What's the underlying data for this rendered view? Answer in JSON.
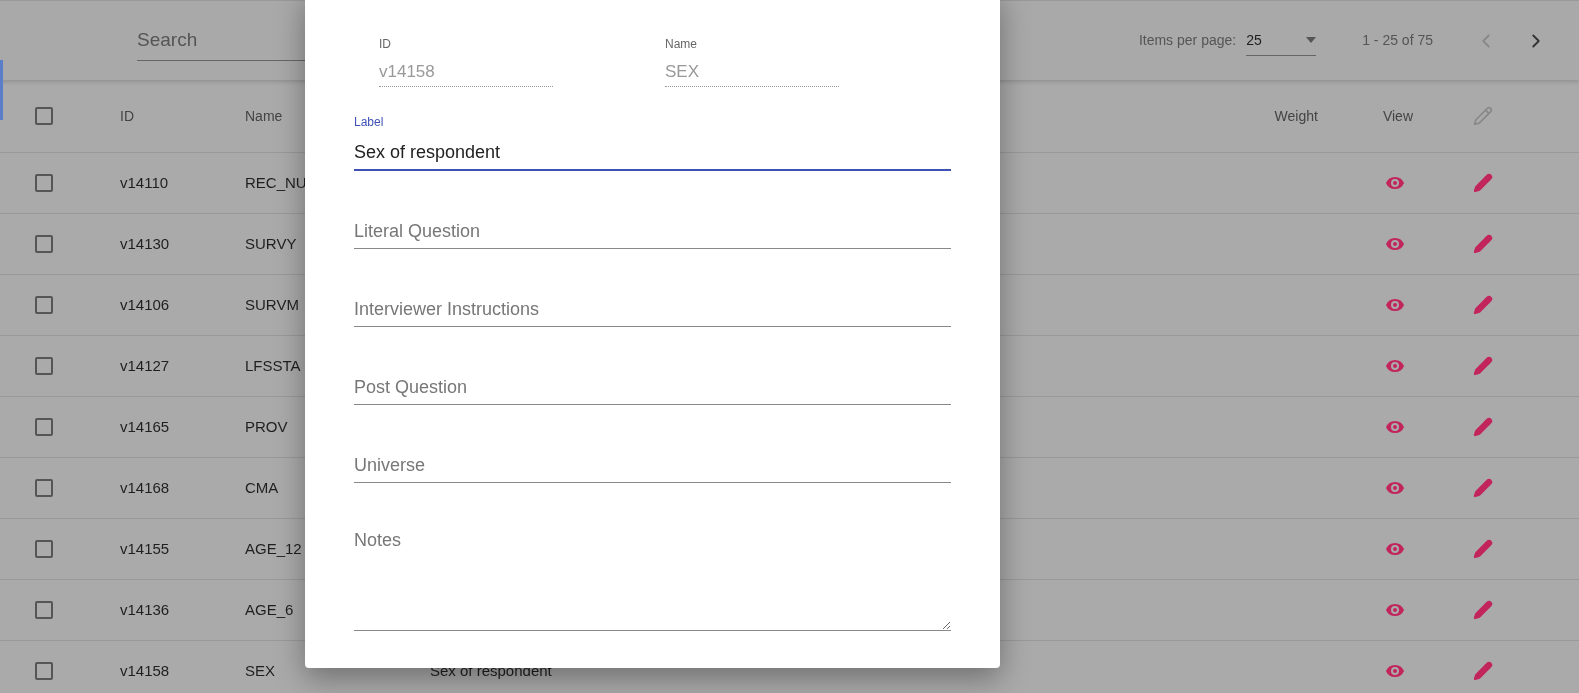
{
  "toolbar": {
    "search": {
      "placeholder": "Search"
    },
    "items_per_page": {
      "label": "Items per page:",
      "value": "25"
    },
    "range": "1 - 25 of 75",
    "prev_disabled": true,
    "next_disabled": false
  },
  "table": {
    "header_checked": false,
    "columns": [
      "ID",
      "Name",
      "Weight",
      "View"
    ],
    "rows": [
      {
        "id": "v14110",
        "name": "REC_NU",
        "label": "",
        "checked": false
      },
      {
        "id": "v14130",
        "name": "SURVY",
        "label": "",
        "checked": false
      },
      {
        "id": "v14106",
        "name": "SURVM",
        "label": "",
        "checked": false
      },
      {
        "id": "v14127",
        "name": "LFSSTA",
        "label": "",
        "checked": false
      },
      {
        "id": "v14165",
        "name": "PROV",
        "label": "",
        "checked": false
      },
      {
        "id": "v14168",
        "name": "CMA",
        "label": "",
        "checked": false
      },
      {
        "id": "v14155",
        "name": "AGE_12",
        "label": "",
        "checked": false
      },
      {
        "id": "v14136",
        "name": "AGE_6",
        "label": "",
        "checked": false
      },
      {
        "id": "v14158",
        "name": "SEX",
        "label": "Sex of respondent",
        "checked": false
      }
    ]
  },
  "dialog": {
    "id_field": {
      "label": "ID",
      "value": "v14158"
    },
    "name_field": {
      "label": "Name",
      "value": "SEX"
    },
    "label_field": {
      "label": "Label",
      "value": "Sex of respondent",
      "focused": true
    },
    "fields": [
      {
        "kind": "input",
        "placeholder": "Literal Question"
      },
      {
        "kind": "input",
        "placeholder": "Interviewer Instructions"
      },
      {
        "kind": "input",
        "placeholder": "Post Question"
      },
      {
        "kind": "input",
        "placeholder": "Universe"
      },
      {
        "kind": "textarea",
        "placeholder": "Notes"
      }
    ]
  }
}
